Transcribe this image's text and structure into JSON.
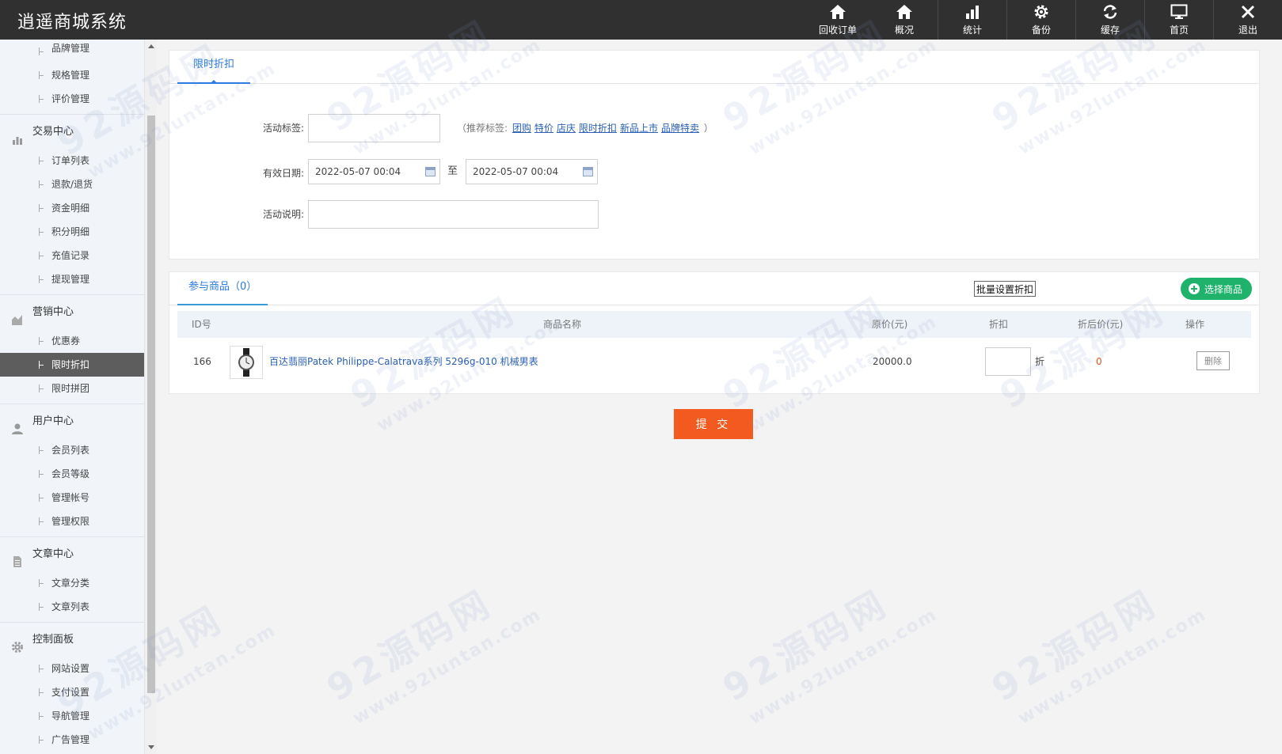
{
  "app": {
    "title": "逍遥商城系统"
  },
  "topnav": [
    {
      "label": "回收订单",
      "icon": "home-icon"
    },
    {
      "label": "概况",
      "icon": "home-icon"
    },
    {
      "label": "统计",
      "icon": "bar-chart-icon"
    },
    {
      "label": "备份",
      "icon": "gear-icon"
    },
    {
      "label": "缓存",
      "icon": "refresh-icon"
    },
    {
      "label": "首页",
      "icon": "monitor-icon"
    },
    {
      "label": "退出",
      "icon": "close-icon"
    }
  ],
  "sidebar": {
    "top_items": [
      "品牌管理",
      "规格管理",
      "评价管理"
    ],
    "groups": [
      {
        "label": "交易中心",
        "icon": "bar-chart-icon",
        "items": [
          "订单列表",
          "退款/退货",
          "资金明细",
          "积分明细",
          "充值记录",
          "提现管理"
        ]
      },
      {
        "label": "营销中心",
        "icon": "area-chart-icon",
        "items": [
          "优惠券",
          "限时折扣",
          "限时拼团"
        ],
        "active": "限时折扣"
      },
      {
        "label": "用户中心",
        "icon": "user-icon",
        "items": [
          "会员列表",
          "会员等级",
          "管理帐号",
          "管理权限"
        ]
      },
      {
        "label": "文章中心",
        "icon": "document-icon",
        "items": [
          "文章分类",
          "文章列表"
        ]
      },
      {
        "label": "控制面板",
        "icon": "gear-icon",
        "items": [
          "网站设置",
          "支付设置",
          "导航管理",
          "广告管理"
        ]
      }
    ]
  },
  "form": {
    "tab_label": "限时折扣",
    "tag_label": "活动标签:",
    "tag_value": "",
    "hint_prefix": "（推荐标签:",
    "hint_suffix": "）",
    "recommended_tags": [
      "团购",
      "特价",
      "店庆",
      "限时折扣",
      "新品上市",
      "品牌特卖"
    ],
    "date_label": "有效日期:",
    "start_date": "2022-05-07 00:04",
    "to_text": "至",
    "end_date": "2022-05-07 00:04",
    "desc_label": "活动说明:",
    "desc_value": ""
  },
  "goods": {
    "tab_label": "参与商品（0）",
    "batch_button": "批量设置折扣",
    "select_button": "选择商品",
    "columns": [
      "ID号",
      "商品名称",
      "原价(元)",
      "折扣",
      "折后价(元)",
      "操作"
    ],
    "rows": [
      {
        "id": "166",
        "name": "百达翡丽Patek Philippe-Calatrava系列 5296g-010 机械男表",
        "price": "20000.0",
        "discount": "",
        "discount_unit": "折",
        "final_price": "0",
        "delete_label": "删除"
      }
    ],
    "final_price_color": "#e8541c"
  },
  "submit_label": "提 交",
  "watermark": {
    "site": "92源码网",
    "url": "www.92luntan.com"
  },
  "colors": {
    "topbar": "#303030",
    "accent": "#2a7ae2",
    "submit": "#f25a1f",
    "select": "#1fb26b"
  }
}
